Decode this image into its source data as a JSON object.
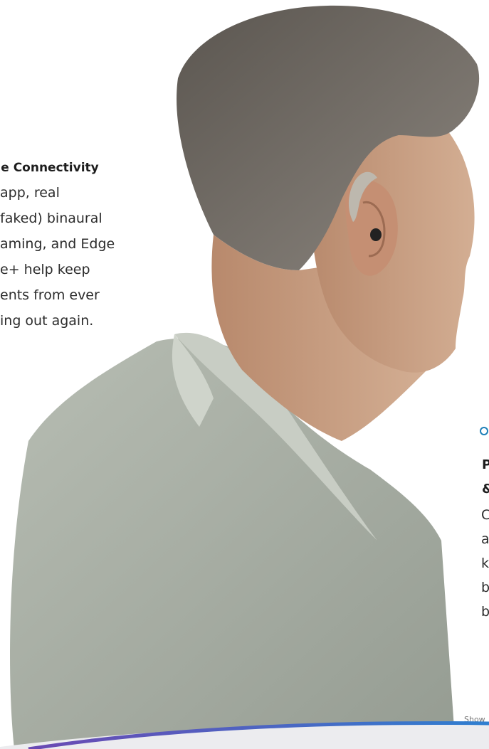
{
  "left_feature": {
    "title": "atile Connectivity",
    "lines": [
      "app, real",
      "faked) binaural",
      "aming, and Edge",
      "e+ help keep",
      "ents from ever",
      "ing out again."
    ]
  },
  "right_feature": {
    "title_lines": [
      "P",
      "&"
    ],
    "body_lines": [
      "C",
      "a",
      "k",
      "b",
      "b"
    ]
  },
  "disclaimer": "Show",
  "colors": {
    "accent": "#1d7fb8",
    "gradient_start": "#6b49b3",
    "gradient_end": "#2f7fd0",
    "shirt": "#a9b0a5",
    "skin": "#c9a184",
    "hair": "#6a655f",
    "band": "#ececef"
  },
  "icons": [
    "ring-icon"
  ]
}
